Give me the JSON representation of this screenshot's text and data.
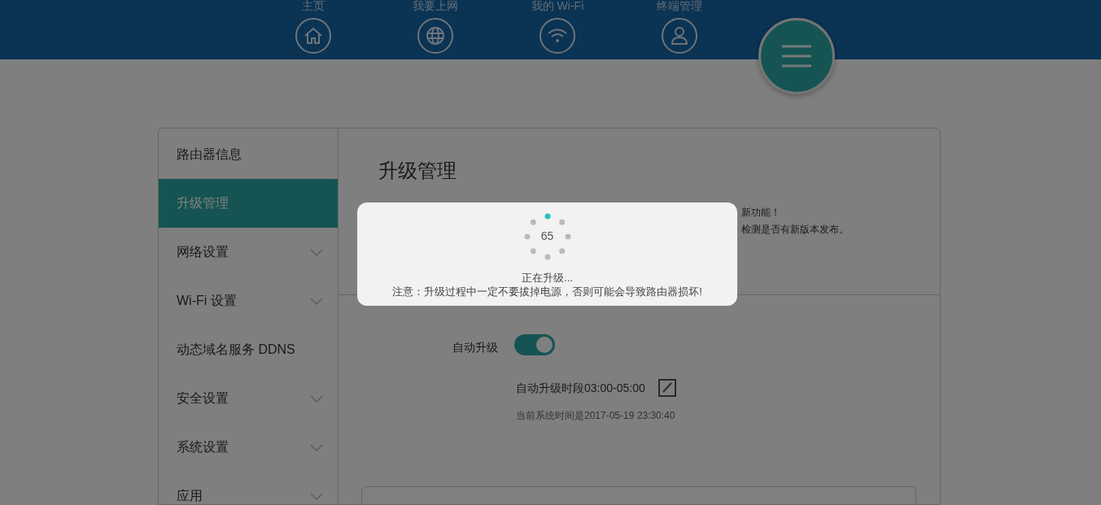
{
  "nav": {
    "items": [
      {
        "label": "主页",
        "kind": "home"
      },
      {
        "label": "我要上网",
        "kind": "globe"
      },
      {
        "label": "我的 Wi-Fi",
        "kind": "wifi"
      },
      {
        "label": "终端管理",
        "kind": "user"
      }
    ]
  },
  "sidebar": {
    "items": [
      {
        "label": "路由器信息",
        "selected": false,
        "kind": "link"
      },
      {
        "label": "升级管理",
        "selected": true,
        "kind": "link"
      },
      {
        "label": "网络设置",
        "selected": false,
        "kind": "group"
      },
      {
        "label": "Wi-Fi 设置",
        "selected": false,
        "kind": "group"
      },
      {
        "label": "动态域名服务 DDNS",
        "selected": false,
        "kind": "link"
      },
      {
        "label": "安全设置",
        "selected": false,
        "kind": "group"
      },
      {
        "label": "系统设置",
        "selected": false,
        "kind": "group"
      },
      {
        "label": "应用",
        "selected": false,
        "kind": "group"
      }
    ]
  },
  "page": {
    "title": "升级管理",
    "notice_fragments": [
      "新功能！",
      "检测是否有新版本发布。"
    ],
    "auto_upgrade": {
      "label": "自动升级",
      "on": true
    },
    "schedule": "自动升级时段03:00-05:00",
    "system_time": "当前系统时间是2017-05-19 23:30:40"
  },
  "dialog": {
    "counter": "65",
    "status": "正在升级...",
    "warning": "注意：升级过程中一定不要拔掉电源，否则可能会导致路由器损坏!"
  }
}
